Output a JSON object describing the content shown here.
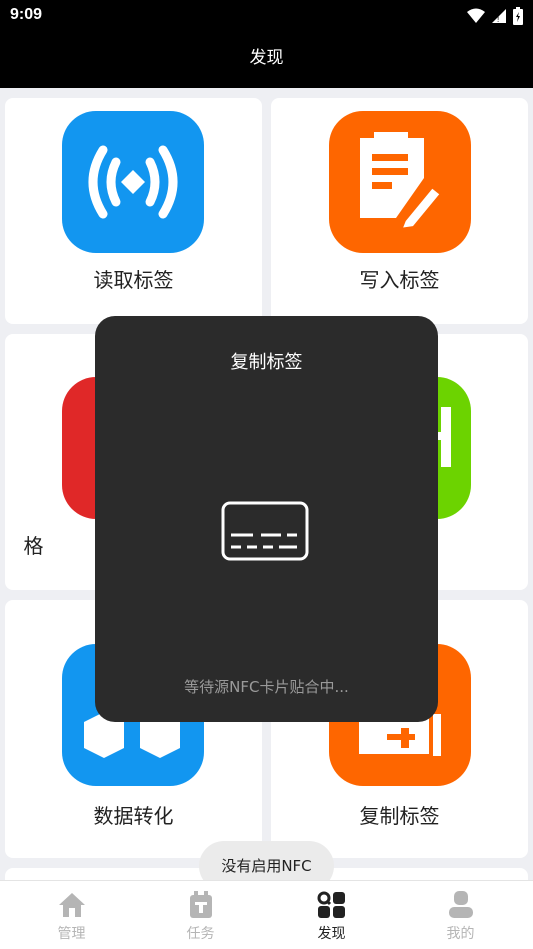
{
  "status_bar": {
    "time": "9:09"
  },
  "header": {
    "title": "发现"
  },
  "cards": [
    {
      "label": "读取标签",
      "icon": "nfc-read-icon",
      "color": "#1296f0"
    },
    {
      "label": "写入标签",
      "icon": "write-edit-icon",
      "color": "#fe6600"
    },
    {
      "label": "格",
      "icon": "format-icon",
      "color": "#e02828"
    },
    {
      "label": "",
      "icon": "green-app-icon",
      "color": "#6cd300"
    },
    {
      "label": "数据转化",
      "icon": "data-convert-icon",
      "color": "#1296f0"
    },
    {
      "label": "复制标签",
      "icon": "copy-tag-icon",
      "color": "#fe6600"
    }
  ],
  "dialog": {
    "title": "复制标签",
    "icon": "card-icon",
    "status": "等待源NFC卡片贴合中..."
  },
  "toast": {
    "text": "没有启用NFC"
  },
  "bottom_nav": [
    {
      "label": "管理",
      "icon": "home-icon",
      "active": false
    },
    {
      "label": "任务",
      "icon": "task-icon",
      "active": false
    },
    {
      "label": "发现",
      "icon": "discover-icon",
      "active": true
    },
    {
      "label": "我的",
      "icon": "profile-icon",
      "active": false
    }
  ],
  "colors": {
    "active": "#222222",
    "inactive": "#b5b5b5",
    "dialog_bg": "#2b2b2b"
  }
}
